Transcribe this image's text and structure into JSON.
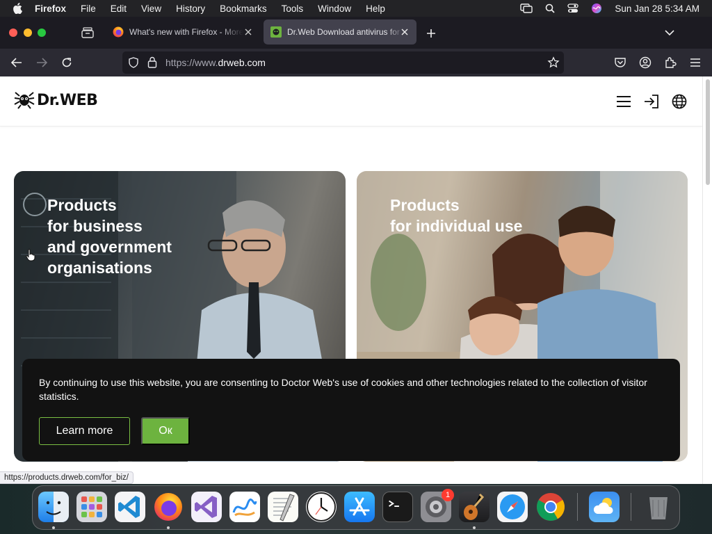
{
  "menubar": {
    "app_name": "Firefox",
    "items": [
      "File",
      "Edit",
      "View",
      "History",
      "Bookmarks",
      "Tools",
      "Window",
      "Help"
    ],
    "clock": "Sun Jan 28  5:34 AM"
  },
  "tabs": [
    {
      "title": "What's new with Firefox - More",
      "favicon": "firefox-icon"
    },
    {
      "title": "Dr.Web Download antivirus for PC",
      "favicon": "drweb-icon",
      "active": true
    }
  ],
  "navbar": {
    "url_prefix": "https://www.",
    "url_domain": "drweb.com"
  },
  "site": {
    "logo_text": "Dr.WEB",
    "cards": [
      {
        "title": "Products\nfor business\nand government\norganisations"
      },
      {
        "title": "Products\nfor individual use"
      }
    ],
    "cookie": {
      "message": "By continuing to use this website, you are consenting to Doctor Web's use of cookies and other technologies related to the collection of visitor statistics.",
      "learn_more": "Learn more",
      "ok": "Ок"
    }
  },
  "status_url": "https://products.drweb.com/for_biz/",
  "dock": {
    "apps": [
      "Finder",
      "Launchpad",
      "Visual Studio Code",
      "Firefox",
      "Visual Studio",
      "Freeform",
      "TextEdit",
      "Clock",
      "App Store",
      "Terminal",
      "System Settings",
      "GarageBand",
      "Safari",
      "Chrome",
      "Weather",
      "Trash"
    ],
    "settings_badge": "1"
  },
  "colors": {
    "accent_green": "#6db33f",
    "cookie_bg": "#121212",
    "tab_active": "#42414d"
  }
}
